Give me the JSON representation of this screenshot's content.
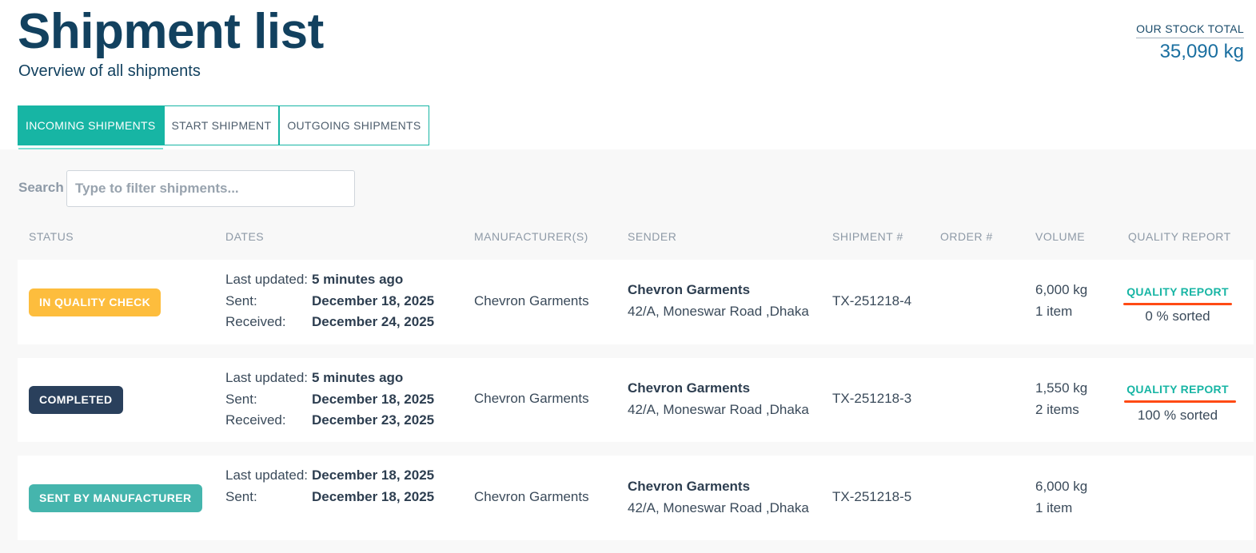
{
  "header": {
    "title": "Shipment list",
    "subtitle": "Overview of all shipments",
    "stock_label": "OUR STOCK TOTAL",
    "stock_value": "35,090 kg"
  },
  "tabs": [
    {
      "label": "INCOMING SHIPMENTS",
      "active": true
    },
    {
      "label": "START SHIPMENT",
      "active": false
    },
    {
      "label": "OUTGOING SHIPMENTS",
      "active": false
    }
  ],
  "search": {
    "label": "Search",
    "placeholder": "Type to filter shipments...",
    "value": ""
  },
  "table": {
    "columns": [
      "STATUS",
      "DATES",
      "MANUFACTURER(S)",
      "SENDER",
      "SHIPMENT #",
      "ORDER #",
      "VOLUME",
      "QUALITY REPORT"
    ],
    "rows": [
      {
        "status": "IN QUALITY CHECK",
        "status_color": "#fdbd3d",
        "dates": [
          {
            "key": "Last updated:",
            "value": "5 minutes ago"
          },
          {
            "key": "Sent:",
            "value": "December 18, 2025"
          },
          {
            "key": "Received:",
            "value": "December 24, 2025"
          }
        ],
        "manufacturer": "Chevron Garments",
        "sender_name": "Chevron Garments",
        "sender_address": "42/A, Moneswar Road ,Dhaka",
        "shipment_no": "TX-251218-4",
        "order_no": "",
        "volume_weight": "6,000 kg",
        "volume_items": "1 item",
        "quality_link": "QUALITY REPORT",
        "quality_sorted": "0 % sorted"
      },
      {
        "status": "COMPLETED",
        "status_color": "#2a405c",
        "dates": [
          {
            "key": "Last updated:",
            "value": "5 minutes ago"
          },
          {
            "key": "Sent:",
            "value": "December 18, 2025"
          },
          {
            "key": "Received:",
            "value": "December 23, 2025"
          }
        ],
        "manufacturer": "Chevron Garments",
        "sender_name": "Chevron Garments",
        "sender_address": "42/A, Moneswar Road ,Dhaka",
        "shipment_no": "TX-251218-3",
        "order_no": "",
        "volume_weight": "1,550 kg",
        "volume_items": "2 items",
        "quality_link": "QUALITY REPORT",
        "quality_sorted": "100 % sorted"
      },
      {
        "status": "SENT BY MANUFACTURER",
        "status_color": "#45b5ad",
        "dates": [
          {
            "key": "Last updated:",
            "value": "December 18, 2025"
          },
          {
            "key": "Sent:",
            "value": "December 18, 2025"
          }
        ],
        "manufacturer": "Chevron Garments",
        "sender_name": "Chevron Garments",
        "sender_address": "42/A, Moneswar Road ,Dhaka",
        "shipment_no": "TX-251218-5",
        "order_no": "",
        "volume_weight": "6,000 kg",
        "volume_items": "1 item"
      }
    ]
  },
  "colors": {
    "accent": "#17b5a4",
    "title": "#12415f",
    "annotation_underline": "#ff4a14"
  }
}
